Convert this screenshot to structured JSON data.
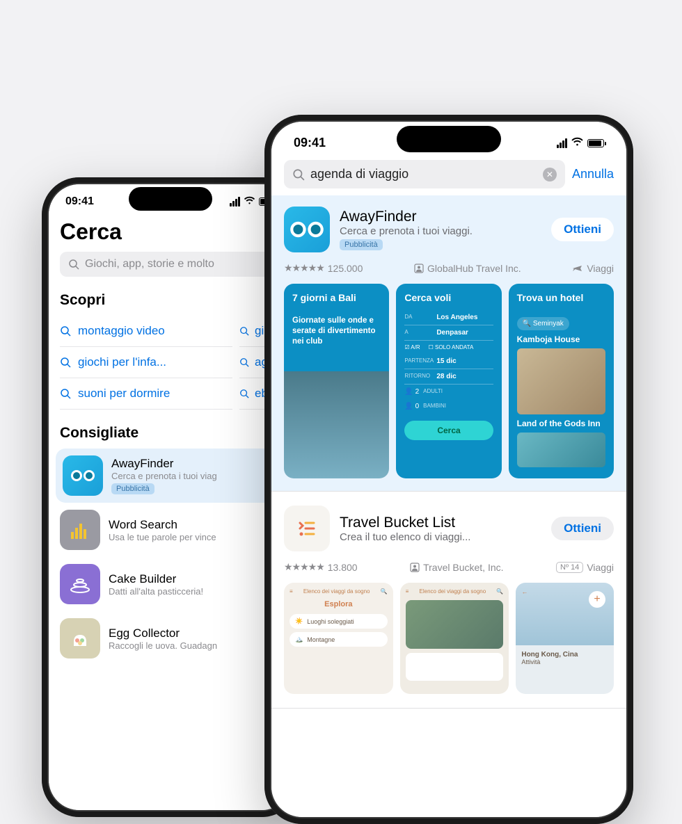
{
  "status": {
    "time": "09:41"
  },
  "back": {
    "title": "Cerca",
    "search_placeholder": "Giochi, app, storie e molto",
    "discover_heading": "Scopri",
    "discover": {
      "c1r1": "montaggio video",
      "c1r2": "giochi per l'infa...",
      "c1r3": "suoni per dormire",
      "c2r1": "gi",
      "c2r2": "ag",
      "c2r3": "eb"
    },
    "suggested_heading": "Consigliate",
    "away": {
      "name": "AwayFinder",
      "sub": "Cerca e prenota i tuoi viag",
      "badge": "Pubblicità"
    },
    "word": {
      "name": "Word Search",
      "sub": "Usa le tue parole per vince"
    },
    "cake": {
      "name": "Cake Builder",
      "sub": "Datti all'alta pasticceria!"
    },
    "egg": {
      "name": "Egg Collector",
      "sub": "Raccogli le uova. Guadagn"
    }
  },
  "front": {
    "query": "agenda di viaggio",
    "cancel": "Annulla",
    "away": {
      "name": "AwayFinder",
      "sub": "Cerca e prenota i tuoi viaggi.",
      "badge": "Pubblicità",
      "get": "Ottieni",
      "ratings": "125.000",
      "dev": "GlobalHub Travel Inc.",
      "category": "Viaggi"
    },
    "shot1": {
      "title": "7 giorni a Bali",
      "desc": "Giornate sulle onde e serate di divertimento nei club"
    },
    "shot2": {
      "title": "Cerca voli",
      "from_lbl": "DA",
      "from": "Los Angeles",
      "to_lbl": "A",
      "to": "Denpasar",
      "rt": "A/R",
      "ow": "SOLO ANDATA",
      "dep_lbl": "PARTENZA",
      "dep": "15 dic",
      "ret_lbl": "RITORNO",
      "ret": "28 dic",
      "ad_n": "2",
      "ad_lbl": "ADULTI",
      "ch_n": "0",
      "ch_lbl": "BAMBINI",
      "btn": "Cerca"
    },
    "shot3": {
      "title": "Trova un hotel",
      "search": "Seminyak",
      "h1": "Kamboja House",
      "h2": "Land of the Gods Inn"
    },
    "bucket": {
      "name": "Travel Bucket List",
      "sub": "Crea il tuo elenco di viaggi...",
      "get": "Ottieni",
      "ratings": "13.800",
      "dev": "Travel Bucket, Inc.",
      "rank": "Nº 14",
      "category": "Viaggi"
    },
    "shotB1": {
      "hdr": "Elenco dei viaggi da sogno",
      "explore": "Esplora",
      "p1": "Luoghi soleggiati",
      "p2": "Montagne"
    },
    "shotB2": {
      "hdr": "Elenco dei viaggi da sogno"
    },
    "shotB3": {
      "city": "Hong Kong, Cina",
      "sub": "Attività"
    }
  }
}
